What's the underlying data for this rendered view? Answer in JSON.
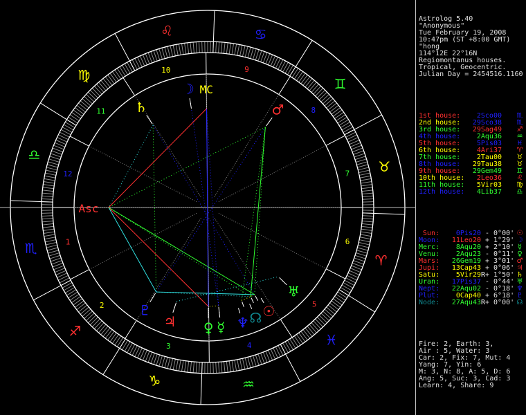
{
  "header": {
    "lines": [
      "Astrolog 5.40",
      "\"Anonymous\"",
      "Tue February 19, 2008",
      "10:47pm (ST +8:00 GMT)",
      "\"hong",
      "114°12E 22°16N",
      "Regiomontanus houses.",
      "Tropical, Geocentric.",
      "Julian Day = 2454516.1160"
    ]
  },
  "colors": {
    "red": "#ff3030",
    "yellow": "#ffff00",
    "green": "#30ff30",
    "blue": "#2020ff",
    "teal": "#108890",
    "white": "#ffffff",
    "gray": "#909090",
    "cyan": "#30e0e0"
  },
  "houses": [
    {
      "label": "1st house:",
      "value": "2Sco00",
      "lon": 212.0,
      "num": "1",
      "label_color": "#ff3030",
      "value_color": "#2020ff",
      "glyph": "♏"
    },
    {
      "label": "2nd house:",
      "value": "29Sco38",
      "lon": 239.63,
      "num": "2",
      "label_color": "#ffff00",
      "value_color": "#2020ff",
      "glyph": "♏"
    },
    {
      "label": "3rd house:",
      "value": "29Sag49",
      "lon": 269.82,
      "num": "3",
      "label_color": "#30ff30",
      "value_color": "#ff3030",
      "glyph": "♐"
    },
    {
      "label": "4th house:",
      "value": "2Aqu36",
      "lon": 302.6,
      "num": "4",
      "label_color": "#2020ff",
      "value_color": "#30ff30",
      "glyph": "♒"
    },
    {
      "label": "5th house:",
      "value": "5Pis03",
      "lon": 335.05,
      "num": "5",
      "label_color": "#ff3030",
      "value_color": "#2020ff",
      "glyph": "♓"
    },
    {
      "label": "6th house:",
      "value": "4Ari37",
      "lon": 4.62,
      "num": "6",
      "label_color": "#ffff00",
      "value_color": "#ff3030",
      "glyph": "♈"
    },
    {
      "label": "7th house:",
      "value": "2Tau00",
      "lon": 32.0,
      "num": "7",
      "label_color": "#30ff30",
      "value_color": "#ffff00",
      "glyph": "♉"
    },
    {
      "label": "8th house:",
      "value": "29Tau38",
      "lon": 59.63,
      "num": "8",
      "label_color": "#2020ff",
      "value_color": "#ffff00",
      "glyph": "♉"
    },
    {
      "label": "9th house:",
      "value": "29Gem49",
      "lon": 89.82,
      "num": "9",
      "label_color": "#ff3030",
      "value_color": "#30ff30",
      "glyph": "♊"
    },
    {
      "label": "10th house:",
      "value": "2Leo36",
      "lon": 122.6,
      "num": "10",
      "label_color": "#ffff00",
      "value_color": "#ff3030",
      "glyph": "♌"
    },
    {
      "label": "11th house:",
      "value": "5Vir03",
      "lon": 155.05,
      "num": "11",
      "label_color": "#30ff30",
      "value_color": "#ffff00",
      "glyph": "♍"
    },
    {
      "label": "12th house:",
      "value": "4Lib37",
      "lon": 184.62,
      "num": "12",
      "label_color": "#2020ff",
      "value_color": "#30ff30",
      "glyph": "♎"
    }
  ],
  "planets": [
    {
      "name": "Sun:",
      "value": "0Pis20",
      "retro": "",
      "aspect": "- 0°00'",
      "lon": 330.33,
      "glyph": "☉",
      "name_color": "#ff3030",
      "value_color": "#2020ff"
    },
    {
      "name": "Moon:",
      "value": "11Leo20",
      "retro": "",
      "aspect": "+ 1°29'",
      "lon": 131.33,
      "glyph": "☽",
      "name_color": "#2020ff",
      "value_color": "#ff3030"
    },
    {
      "name": "Merc:",
      "value": "8Aqu20",
      "retro": "",
      "aspect": "+ 2°10'",
      "lon": 308.33,
      "glyph": "☿",
      "name_color": "#30ff30",
      "value_color": "#30ff30"
    },
    {
      "name": "Venu:",
      "value": "2Aqu23",
      "retro": "",
      "aspect": "- 0°11'",
      "lon": 302.38,
      "glyph": "♀",
      "name_color": "#30ff30",
      "value_color": "#30ff30"
    },
    {
      "name": "Mars:",
      "value": "26Gem19",
      "retro": "",
      "aspect": "+ 3°01'",
      "lon": 86.32,
      "glyph": "♂",
      "name_color": "#ff3030",
      "value_color": "#30ff30"
    },
    {
      "name": "Jupi:",
      "value": "13Cap43",
      "retro": "",
      "aspect": "+ 0°06'",
      "lon": 283.72,
      "glyph": "♃",
      "name_color": "#ff3030",
      "value_color": "#ffff00"
    },
    {
      "name": "Satu:",
      "value": "5Vir29",
      "retro": "R",
      "aspect": "+ 1°50'",
      "lon": 155.48,
      "glyph": "♄",
      "name_color": "#ffff00",
      "value_color": "#ffff00"
    },
    {
      "name": "Uran:",
      "value": "17Pis37",
      "retro": "",
      "aspect": "- 0°44'",
      "lon": 347.62,
      "glyph": "♅",
      "name_color": "#30ff30",
      "value_color": "#2020ff"
    },
    {
      "name": "Nept:",
      "value": "22Aqu02",
      "retro": "",
      "aspect": "- 0°18'",
      "lon": 322.03,
      "glyph": "♆",
      "name_color": "#2020ff",
      "value_color": "#30ff30"
    },
    {
      "name": "Plut:",
      "value": "0Cap40",
      "retro": "",
      "aspect": "+ 6°18'",
      "lon": 270.67,
      "glyph": "♇",
      "name_color": "#2020ff",
      "value_color": "#ffff00"
    },
    {
      "name": "Node:",
      "value": "27Aqu43",
      "retro": "R",
      "aspect": "+ 0°00'",
      "lon": 327.72,
      "glyph": "☊",
      "name_color": "#108890",
      "value_color": "#30ff30"
    }
  ],
  "stats": [
    "Fire: 2, Earth: 3,",
    "Air : 5, Water: 3",
    "Car: 2, Fix: 7, Mut: 4",
    "Yang: 7, Yin: 6",
    "M: 3, N: 8, A: 5, D: 6",
    "Ang: 5, Suc: 3, Cad: 3",
    "Learn: 4, Share: 9"
  ],
  "wheel": {
    "asc_label": "Asc",
    "mc_label": "MC",
    "asc_lon": 212.0,
    "mc_lon": 122.6,
    "signs": [
      {
        "glyph": "♈",
        "color": "#ff3030"
      },
      {
        "glyph": "♉",
        "color": "#ffff00"
      },
      {
        "glyph": "♊",
        "color": "#30ff30"
      },
      {
        "glyph": "♋",
        "color": "#2020ff"
      },
      {
        "glyph": "♌",
        "color": "#ff3030"
      },
      {
        "glyph": "♍",
        "color": "#ffff00"
      },
      {
        "glyph": "♎",
        "color": "#30ff30"
      },
      {
        "glyph": "♏",
        "color": "#2020ff"
      },
      {
        "glyph": "♐",
        "color": "#ff3030"
      },
      {
        "glyph": "♑",
        "color": "#ffff00"
      },
      {
        "glyph": "♒",
        "color": "#30ff30"
      },
      {
        "glyph": "♓",
        "color": "#2020ff"
      }
    ]
  }
}
